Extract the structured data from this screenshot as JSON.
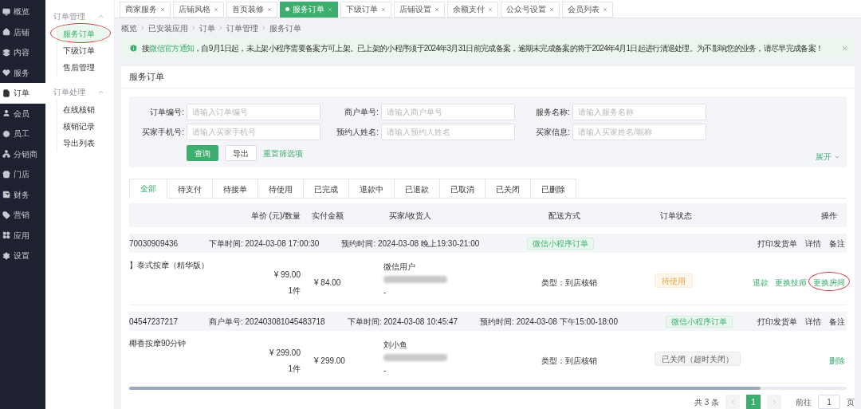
{
  "sidebar": {
    "items": [
      {
        "label": "概览",
        "selected": false
      },
      {
        "label": "店铺",
        "selected": false
      },
      {
        "label": "内容",
        "selected": false
      },
      {
        "label": "服务",
        "selected": false
      },
      {
        "label": "订单",
        "selected": true
      },
      {
        "label": "会员",
        "selected": false
      },
      {
        "label": "员工",
        "selected": false
      },
      {
        "label": "分销商",
        "selected": false
      },
      {
        "label": "门店",
        "selected": false
      },
      {
        "label": "财务",
        "selected": false
      },
      {
        "label": "营销",
        "selected": false
      },
      {
        "label": "应用",
        "selected": false
      },
      {
        "label": "设置",
        "selected": false
      }
    ]
  },
  "submenu": {
    "groups": [
      {
        "title": "订单管理",
        "expanded": true,
        "items": [
          {
            "label": "服务订单",
            "selected": true,
            "circled": true
          },
          {
            "label": "下级订单",
            "selected": false,
            "circled": false
          },
          {
            "label": "售后管理",
            "selected": false,
            "circled": false
          }
        ]
      },
      {
        "title": "订单处理",
        "expanded": true,
        "items": [
          {
            "label": "在线核销",
            "selected": false,
            "circled": false
          },
          {
            "label": "核销记录",
            "selected": false,
            "circled": false
          },
          {
            "label": "导出列表",
            "selected": false,
            "circled": false
          }
        ]
      }
    ]
  },
  "page_tabs": [
    {
      "label": "商家服务",
      "selected": false
    },
    {
      "label": "店铺风格",
      "selected": false
    },
    {
      "label": "首页装修",
      "selected": false
    },
    {
      "label": "服务订单",
      "selected": true
    },
    {
      "label": "下级订单",
      "selected": false
    },
    {
      "label": "店铺设置",
      "selected": false
    },
    {
      "label": "余额支付",
      "selected": false
    },
    {
      "label": "公众号设置",
      "selected": false
    },
    {
      "label": "会员列表",
      "selected": false
    }
  ],
  "breadcrumb": [
    "概览",
    "已安装应用",
    "订单",
    "订单管理",
    "服务订单"
  ],
  "notice": {
    "prefix": "接",
    "link": "微信官方通知",
    "text": "，自9月1日起，未上架小程序需要备案方可上架。已上架的小程序须于2024年3月31日前完成备案，逾期未完成备案的将于2024年4月1日起进行清退处理。为不影响您的业务，请尽早完成备案！"
  },
  "card": {
    "title": "服务订单"
  },
  "filters": [
    {
      "label": "订单编号:",
      "placeholder": "请输入订单编号"
    },
    {
      "label": "商户单号:",
      "placeholder": "请输入商户单号"
    },
    {
      "label": "服务名称:",
      "placeholder": "请输入服务名称"
    },
    {
      "label": "买家手机号:",
      "placeholder": "请输入买家手机号"
    },
    {
      "label": "预约人姓名:",
      "placeholder": "请输入预约人姓名"
    },
    {
      "label": "买家信息:",
      "placeholder": "请输入买家姓名/昵称"
    }
  ],
  "filter_buttons": {
    "search": "查询",
    "export": "导出",
    "reset": "重置筛选项",
    "expand": "展开"
  },
  "status_tabs": [
    {
      "label": "全部",
      "selected": true
    },
    {
      "label": "待支付",
      "selected": false
    },
    {
      "label": "待接单",
      "selected": false
    },
    {
      "label": "待使用",
      "selected": false
    },
    {
      "label": "已完成",
      "selected": false
    },
    {
      "label": "退款中",
      "selected": false
    },
    {
      "label": "已退款",
      "selected": false
    },
    {
      "label": "已取消",
      "selected": false
    },
    {
      "label": "已关闭",
      "selected": false
    },
    {
      "label": "已删除",
      "selected": false
    }
  ],
  "table": {
    "columns": [
      "单价 (元)/数量",
      "实付金额",
      "买家/收货人",
      "配送方式",
      "订单状态",
      "操作"
    ]
  },
  "orders": [
    {
      "order_no": "70030909436",
      "meta": [
        {
          "label": "下单时间:",
          "value": "2024-03-08 17:00:30"
        },
        {
          "label": "预约时间:",
          "value": "2024-03-08 晚上19:30-21:00"
        }
      ],
      "source": "微信小程序订单",
      "header_actions": [
        "打印发货单",
        "详情",
        "备注"
      ],
      "product": "】泰式按摩（精华版）",
      "price": "¥ 99.00",
      "quantity": "1件",
      "paid": "¥ 84.00",
      "buyer_name": "微信用户",
      "buyer_extra": "-",
      "delivery": "类型：到店核销",
      "status": {
        "label": "待使用",
        "kind": "pending"
      },
      "actions": [
        {
          "label": "退款",
          "circled": false
        },
        {
          "label": "更换技师",
          "circled": false
        },
        {
          "label": "更换房间",
          "circled": true
        }
      ]
    },
    {
      "order_no": "04547237217",
      "meta": [
        {
          "label": "商户单号:",
          "value": "202403081045483718"
        },
        {
          "label": "下单时间:",
          "value": "2024-03-08 10:45:47"
        },
        {
          "label": "预约时间:",
          "value": "2024-03-08 下午15:00-18:00"
        }
      ],
      "source": "微信小程序订单",
      "header_actions": [
        "打印发货单",
        "详情",
        "备注"
      ],
      "product": "椰香按摩90分钟",
      "price": "¥ 299.00",
      "quantity": "1件",
      "paid": "¥ 299.00",
      "buyer_name": "刘小鱼",
      "buyer_extra": "-",
      "delivery": "类型：到店核销",
      "status": {
        "label": "已关闭（超时关闭）",
        "kind": "closed"
      },
      "actions": [
        {
          "label": "删除",
          "circled": false
        }
      ]
    }
  ],
  "pagination": {
    "total": "共 3 条",
    "pages": [
      {
        "label": "1",
        "selected": true
      }
    ],
    "goto_label": "前往",
    "goto_value": "1",
    "page_suffix": "页"
  }
}
